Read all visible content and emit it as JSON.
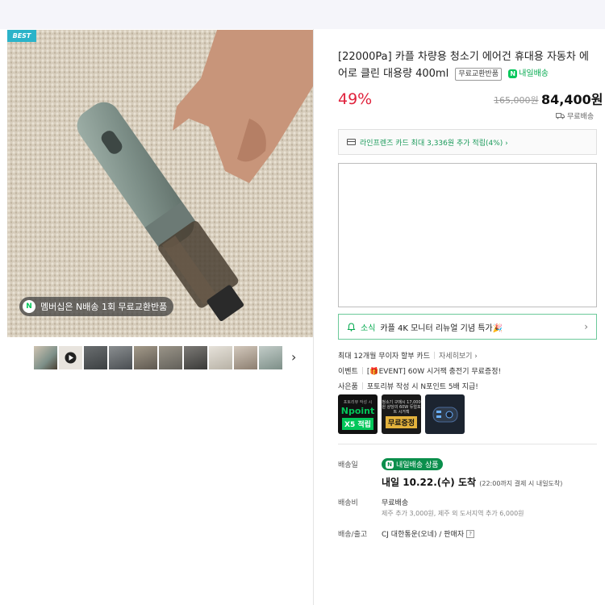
{
  "gallery": {
    "best_badge": "BEST",
    "membership_text": "멤버십은 N배송 1회 무료교환반품",
    "membership_logo": "N",
    "thumbnail_count": 10,
    "next_icon": "›"
  },
  "product": {
    "title_line": "[22000Pa] 카플 차량용 청소기 에어건 휴대용 자동차 에어로 클린 대용량 400ml",
    "free_return_tag": "무료교환반품",
    "tomorrow_delivery_tag": "내일배송",
    "discount_rate": "49%",
    "original_price": "165,000원",
    "sale_price": "84,400원",
    "free_shipping": "무료배송"
  },
  "card_benefit": {
    "text": "라인프렌즈 카드 최대 3,336원 추가 적립(4%) ›"
  },
  "news": {
    "label": "소식",
    "text": "카플 4K 모니터 리뉴얼 기념 특가🎉"
  },
  "info": {
    "installment": "최대 12개월 무이자 할부 카드",
    "installment_more": "자세히보기 ›",
    "event_label": "이벤트",
    "event_text": "[🎁EVENT] 60W 시거잭 충전기 무료증정!",
    "usage_label": "사은품",
    "usage_text": "포토리뷰 작성 시 N포인트 5배 지급!"
  },
  "banners": {
    "b1_small": "포토리뷰 작성 시",
    "b1_npoint": "Npoint",
    "b1_x5": "X5 적립",
    "b2_small": "청소기 구매시 17,000원 상당의 60W 듀얼포트 시거잭",
    "b2_gift": "무료증정"
  },
  "shipping": {
    "date_label": "배송일",
    "tomorrow_badge": "내일배송 상품",
    "arrive_text": "내일 10.22.(수) 도착",
    "arrive_note": "(22:00까지 결제 시 내일도착)",
    "fee_label": "배송비",
    "fee_value": "무료배송",
    "fee_sub": "제주 추가 3,000원, 제주 외 도서지역 추가 6,000원",
    "company_label": "배송/출고",
    "company_value": "CJ 대한통운(오네) / 판매자",
    "help_icon": "?"
  }
}
